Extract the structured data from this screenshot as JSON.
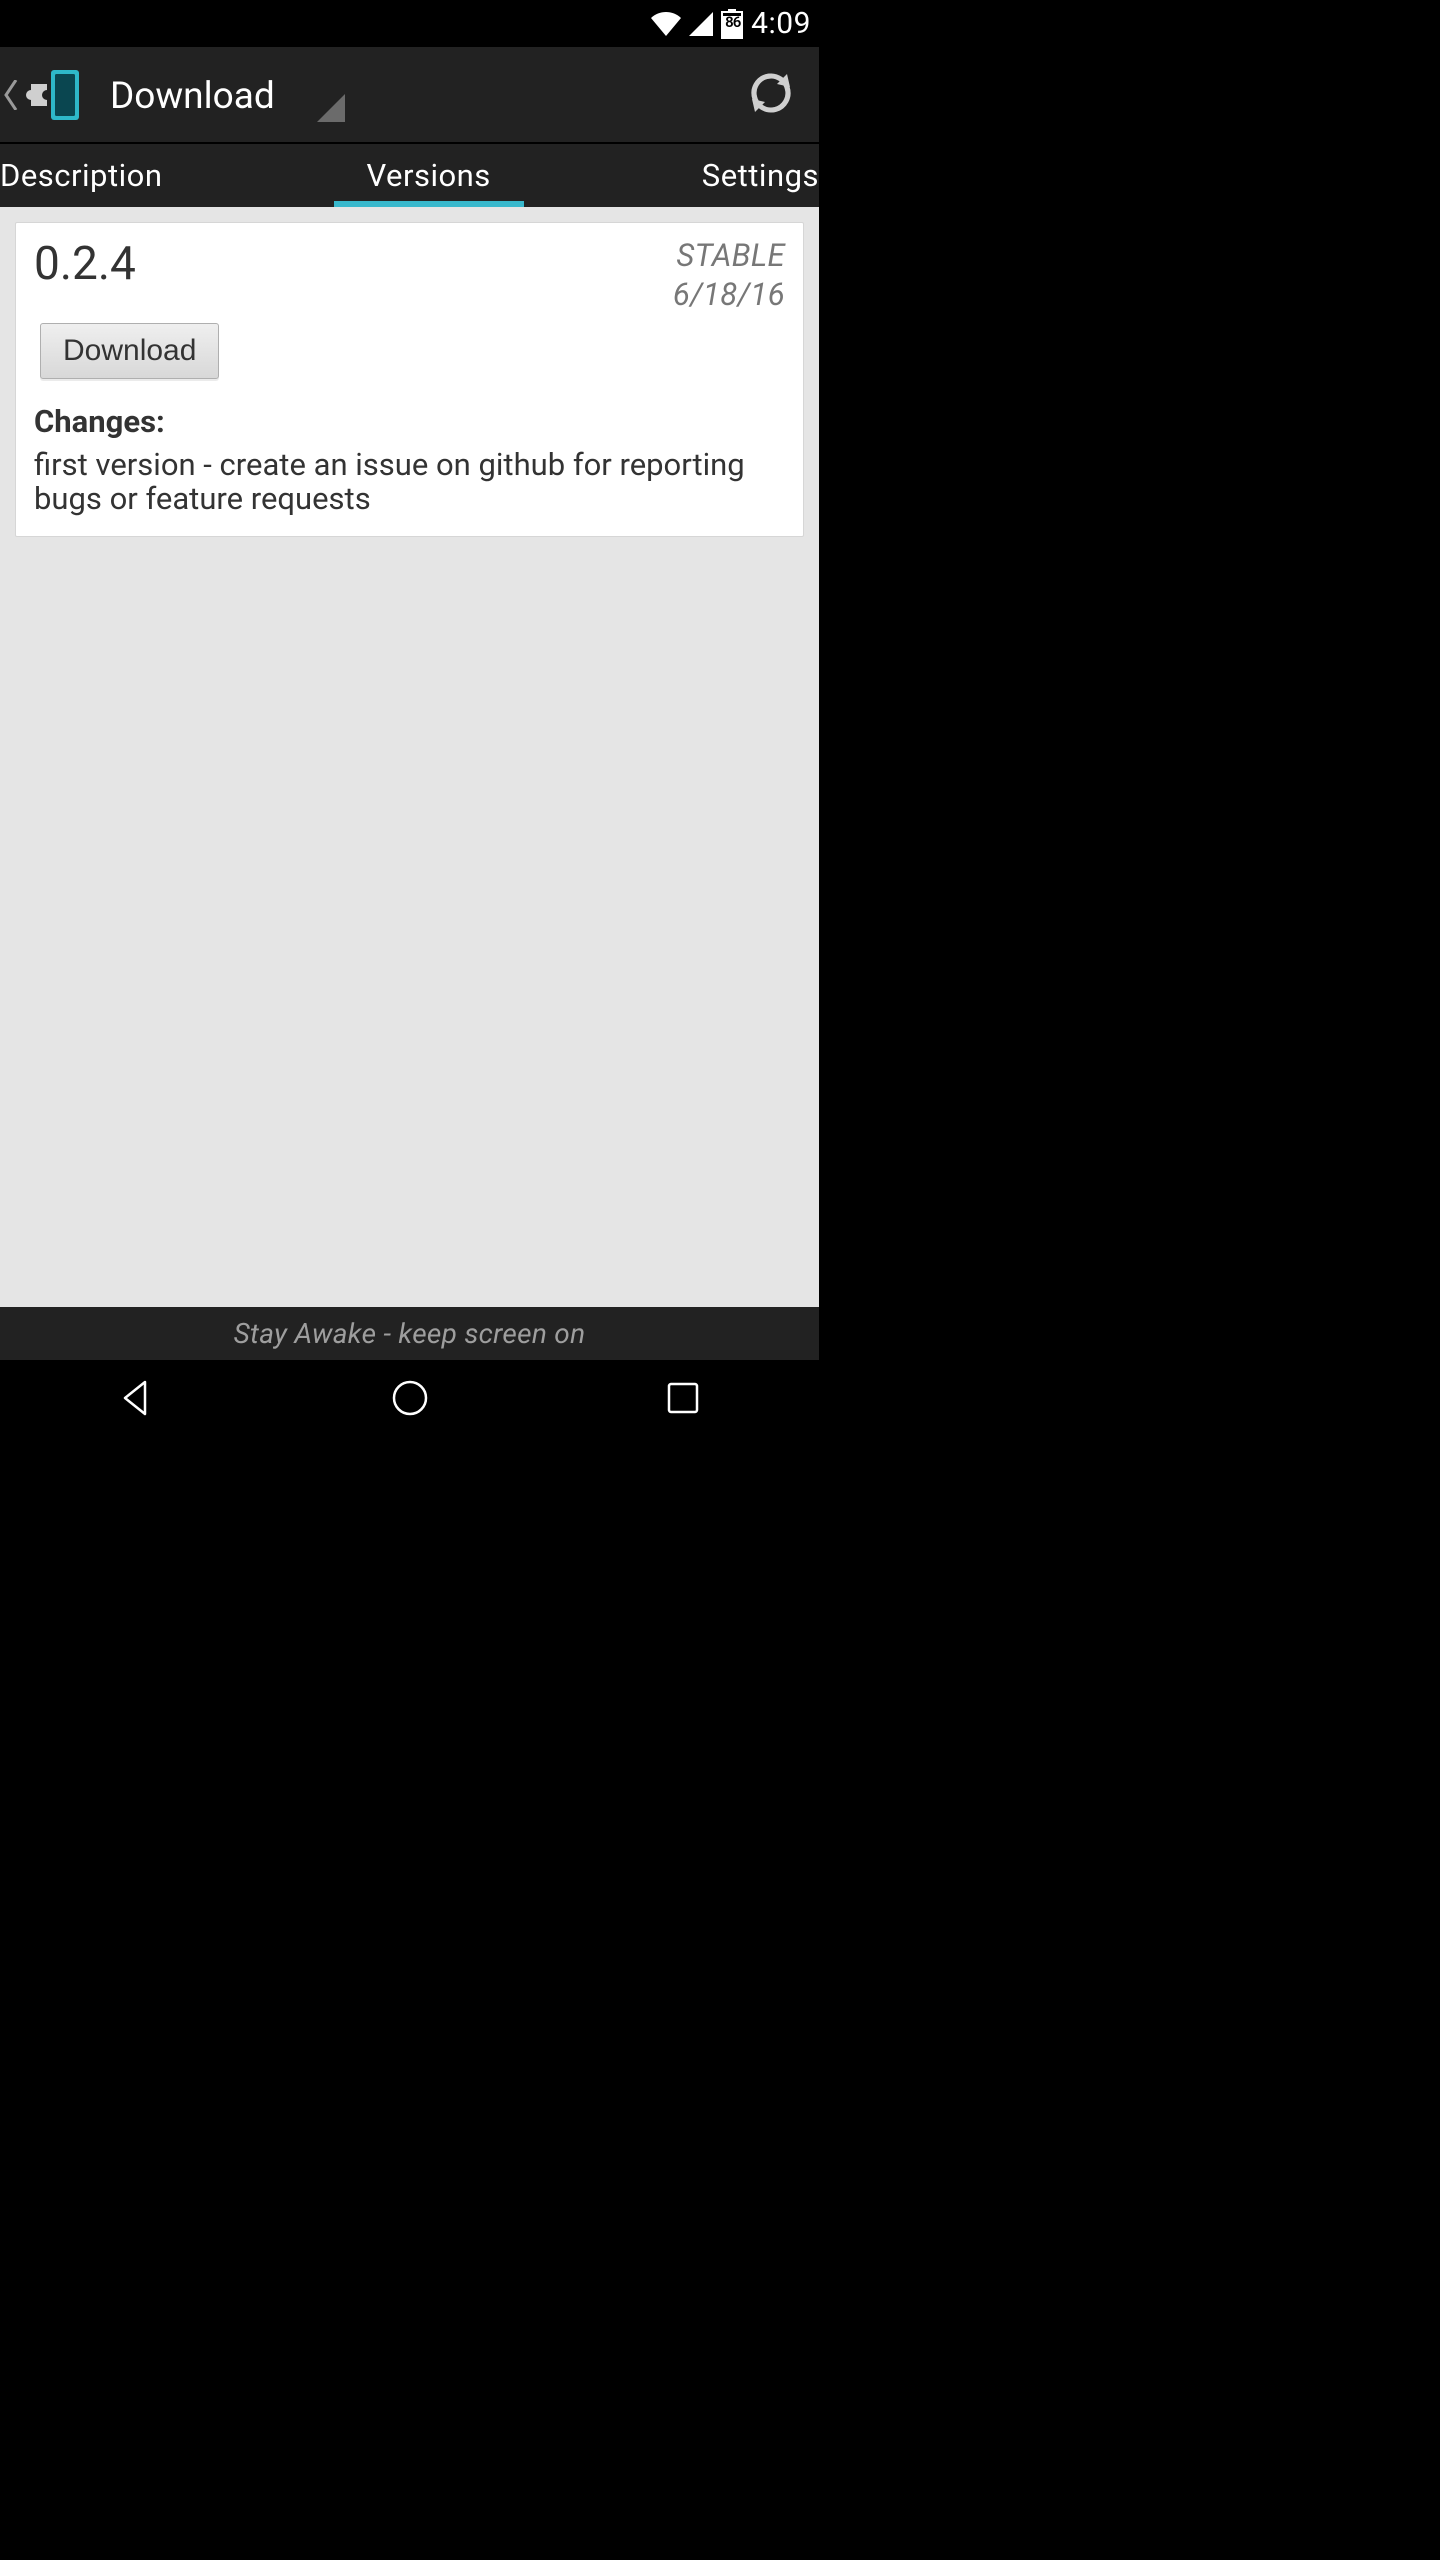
{
  "status_bar": {
    "battery_pct": "86",
    "clock": "4:09"
  },
  "action_bar": {
    "title": "Download"
  },
  "tabs": {
    "description": "Description",
    "versions": "Versions",
    "settings": "Settings",
    "active": "versions"
  },
  "version_card": {
    "version": "0.2.4",
    "stability": "STABLE",
    "date": "6/18/16",
    "download_label": "Download",
    "changes_heading": "Changes:",
    "changes_body": "first version - create an issue on github for reporting bugs or feature requests"
  },
  "footer_hint": "Stay Awake - keep screen on"
}
